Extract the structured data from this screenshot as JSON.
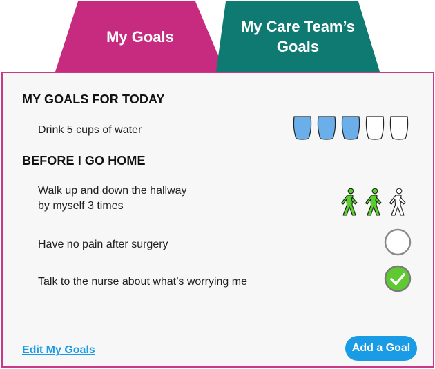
{
  "colors": {
    "my_goals_tab": "#c72b80",
    "care_team_tab": "#0e7a72",
    "panel_border": "#c83a87",
    "accent_blue": "#1a9be6",
    "cup_fill": "#6aaeea",
    "walker_done": "#58d02c",
    "check_green": "#5ec930"
  },
  "tabs": [
    {
      "label": "My Goals",
      "active": true
    },
    {
      "label": "My Care Team’s\nGoals",
      "active": false
    }
  ],
  "sections": {
    "today_heading": "MY GOALS FOR TODAY",
    "home_heading": "BEFORE I GO HOME"
  },
  "goals": {
    "water": {
      "text": "Drink 5 cups of water",
      "progress": {
        "done": 3,
        "total": 5
      },
      "icon": "cup-icon"
    },
    "walk": {
      "text": "Walk up and down the hallway\nby myself 3 times",
      "progress": {
        "done": 2,
        "total": 3
      },
      "icon": "walking-person-icon"
    },
    "pain": {
      "text": "Have no pain after surgery",
      "completed": false,
      "icon": "empty-circle-icon"
    },
    "nurse": {
      "text": "Talk to the nurse about what’s worrying me",
      "completed": true,
      "icon": "checkmark-circle-icon"
    }
  },
  "actions": {
    "edit_label": "Edit My Goals",
    "add_label": "Add a Goal"
  }
}
